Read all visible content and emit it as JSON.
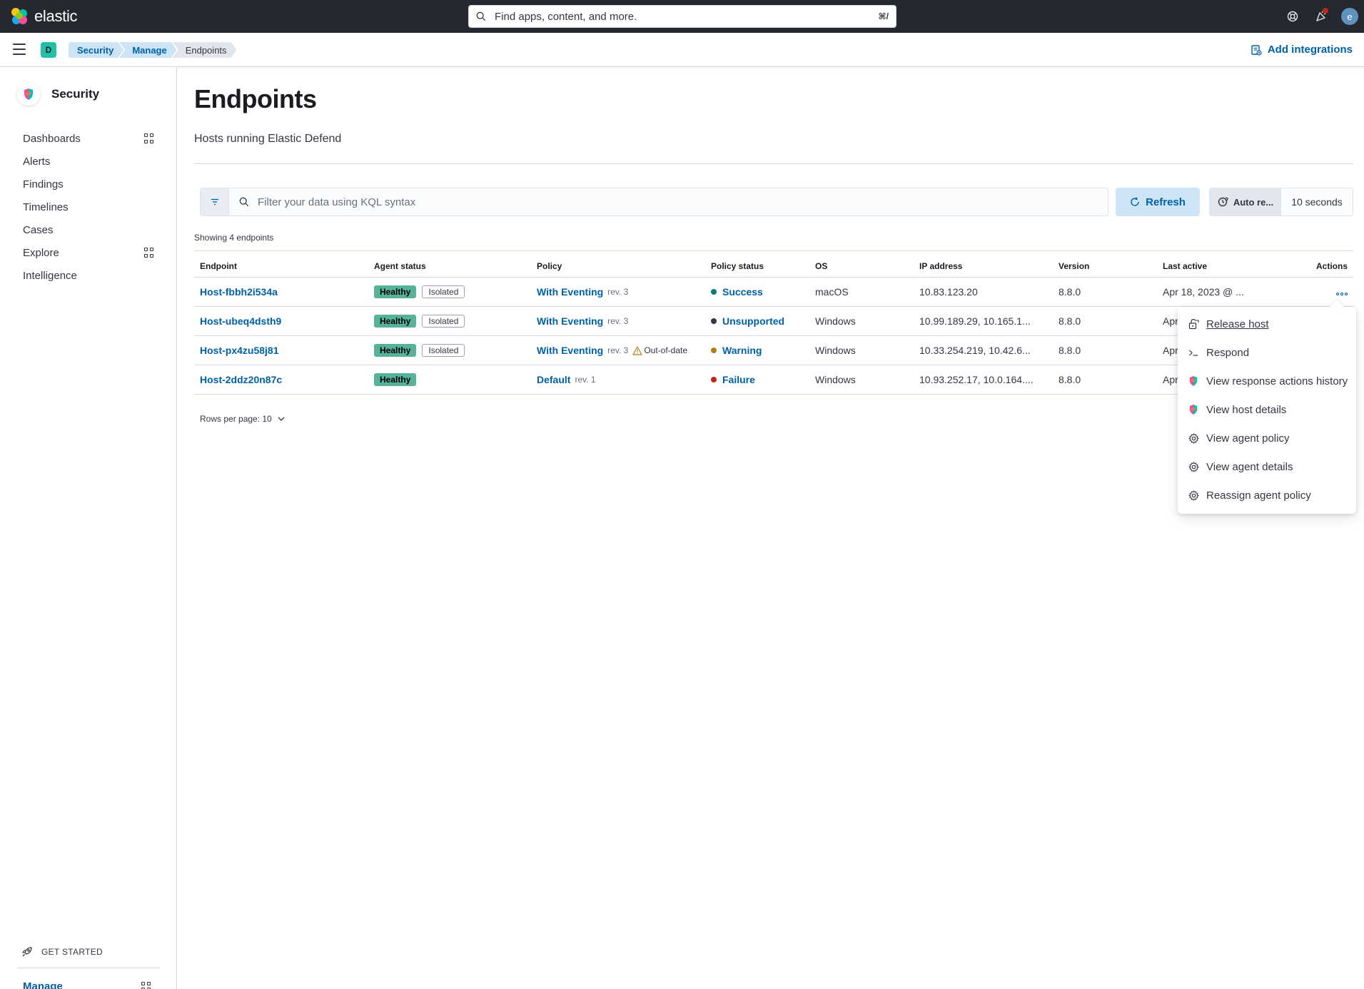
{
  "header": {
    "brand": "elastic",
    "search_placeholder": "Find apps, content, and more.",
    "search_shortcut": "⌘/",
    "avatar_initial": "e"
  },
  "subheader": {
    "space_initial": "D",
    "breadcrumbs": [
      "Security",
      "Manage",
      "Endpoints"
    ],
    "add_integrations": "Add integrations"
  },
  "sidebar": {
    "title": "Security",
    "items": [
      {
        "label": "Dashboards",
        "has_grid": true
      },
      {
        "label": "Alerts",
        "has_grid": false
      },
      {
        "label": "Findings",
        "has_grid": false
      },
      {
        "label": "Timelines",
        "has_grid": false
      },
      {
        "label": "Cases",
        "has_grid": false
      },
      {
        "label": "Explore",
        "has_grid": true
      },
      {
        "label": "Intelligence",
        "has_grid": false
      }
    ],
    "get_started": "GET STARTED",
    "manage": "Manage"
  },
  "page": {
    "title": "Endpoints",
    "description": "Hosts running Elastic Defend",
    "kql_placeholder": "Filter your data using KQL syntax",
    "refresh": "Refresh",
    "auto_refresh": "Auto re...",
    "interval": "10 seconds",
    "showing": "Showing 4 endpoints",
    "rows_per_page": "Rows per page: 10"
  },
  "table": {
    "columns": [
      "Endpoint",
      "Agent status",
      "Policy",
      "Policy status",
      "OS",
      "IP address",
      "Version",
      "Last active",
      "Actions"
    ],
    "rows": [
      {
        "endpoint": "Host-fbbh2i534a",
        "healthy": "Healthy",
        "isolated": "Isolated",
        "policy": "With Eventing",
        "rev": "rev. 3",
        "out_of_date": "",
        "status": "Success",
        "status_color": "#017d73",
        "os": "macOS",
        "ip": "10.83.123.20",
        "version": "8.8.0",
        "last_active": "Apr 18, 2023 @ ..."
      },
      {
        "endpoint": "Host-ubeq4dsth9",
        "healthy": "Healthy",
        "isolated": "Isolated",
        "policy": "With Eventing",
        "rev": "rev. 3",
        "out_of_date": "",
        "status": "Unsupported",
        "status_color": "#343741",
        "os": "Windows",
        "ip": "10.99.189.29, 10.165.1...",
        "version": "8.8.0",
        "last_active": "Apr"
      },
      {
        "endpoint": "Host-px4zu58j81",
        "healthy": "Healthy",
        "isolated": "Isolated",
        "policy": "With Eventing",
        "rev": "rev. 3",
        "out_of_date": "Out-of-date",
        "status": "Warning",
        "status_color": "#b0801a",
        "os": "Windows",
        "ip": "10.33.254.219, 10.42.6...",
        "version": "8.8.0",
        "last_active": "Apr"
      },
      {
        "endpoint": "Host-2ddz20n87c",
        "healthy": "Healthy",
        "isolated": "",
        "policy": "Default",
        "rev": "rev. 1",
        "out_of_date": "",
        "status": "Failure",
        "status_color": "#bd271e",
        "os": "Windows",
        "ip": "10.93.252.17, 10.0.164....",
        "version": "8.8.0",
        "last_active": "Apr"
      }
    ]
  },
  "actions_menu": {
    "items": [
      {
        "label": "Release host",
        "icon": "unlock-icon"
      },
      {
        "label": "Respond",
        "icon": "console-icon"
      },
      {
        "label": "View response actions history",
        "icon": "security-logo-icon"
      },
      {
        "label": "View host details",
        "icon": "security-logo-icon"
      },
      {
        "label": "View agent policy",
        "icon": "gear-icon"
      },
      {
        "label": "View agent details",
        "icon": "gear-icon"
      },
      {
        "label": "Reassign agent policy",
        "icon": "gear-icon"
      }
    ]
  },
  "colors": {
    "link": "#0061a6",
    "healthy": "#54b399",
    "header_bg": "#25282f"
  }
}
